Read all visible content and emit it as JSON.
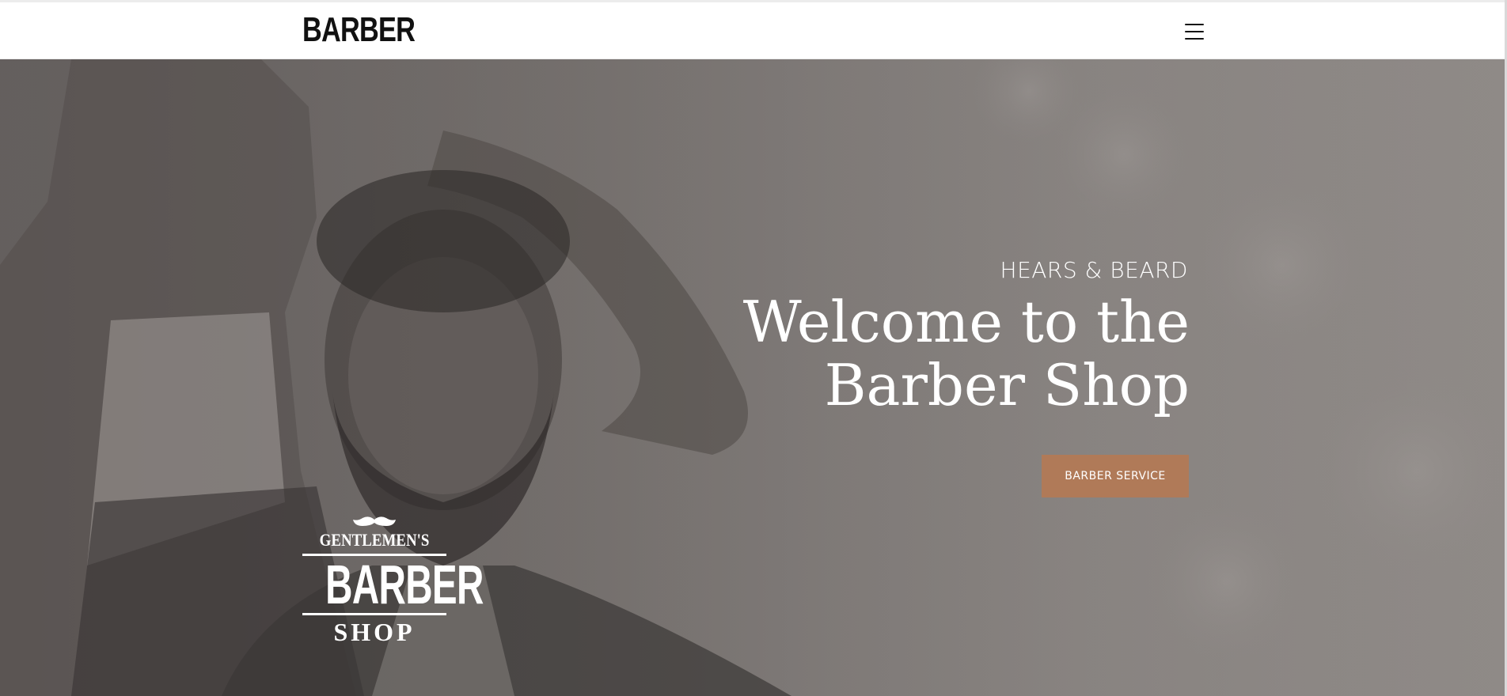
{
  "header": {
    "brand": "BARBER",
    "menu_icon": "hamburger-menu-icon"
  },
  "hero": {
    "subtitle": "HEARS & BEARD",
    "title_line1": "Welcome to the",
    "title_line2": "Barber Shop",
    "cta_label": "BARBER SERVICE",
    "cta_color": "#b07a58"
  },
  "logo": {
    "icon": "mustache-icon",
    "line1": "GENTLEMEN'S",
    "line2": "BARBER",
    "line3": "SHOP"
  }
}
